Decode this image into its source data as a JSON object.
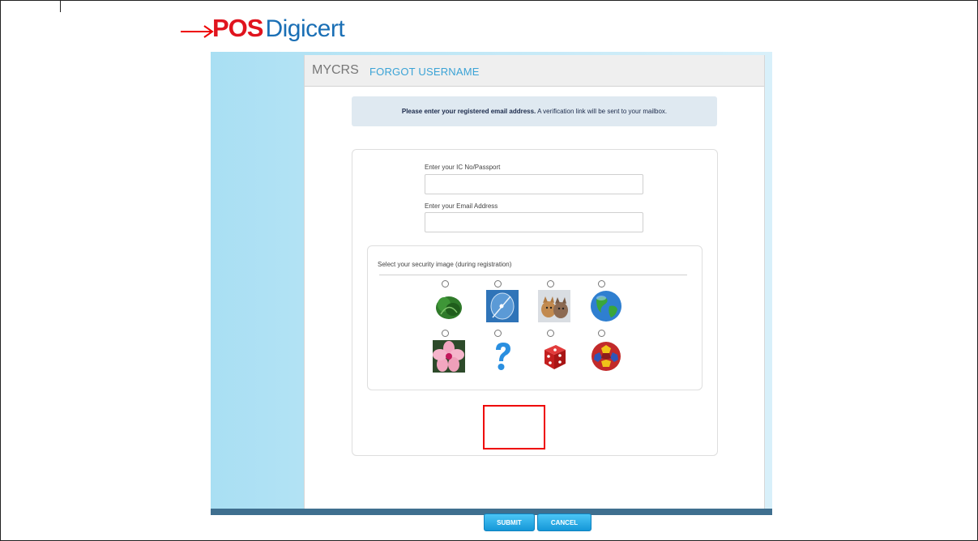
{
  "logo": {
    "brand_red": "POS",
    "brand_blue": "Digicert",
    "red_color": "#e0141e",
    "blue_color": "#1a6fb5"
  },
  "header": {
    "app_name": "MYCRS",
    "page_title": "FORGOT USERNAME"
  },
  "notice": {
    "bold_text": "Please enter your registered email address.",
    "text": " A verification link will be sent to your mailbox."
  },
  "form": {
    "ic_label": "Enter your IC No/Passport",
    "ic_value": "",
    "email_label": "Enter your Email Address",
    "email_value": ""
  },
  "security": {
    "label": "Select your security image (during registration)",
    "images": [
      {
        "icon": "lettuce-icon",
        "selected": false
      },
      {
        "icon": "satellite-dish-icon",
        "selected": false
      },
      {
        "icon": "kittens-icon",
        "selected": false
      },
      {
        "icon": "globe-icon",
        "selected": false
      },
      {
        "icon": "hibiscus-flower-icon",
        "selected": false
      },
      {
        "icon": "question-mark-icon",
        "selected": false
      },
      {
        "icon": "dice-icon",
        "selected": false
      },
      {
        "icon": "polyhedron-ball-icon",
        "selected": false
      }
    ]
  },
  "buttons": {
    "submit": "SUBMIT",
    "cancel": "CANCEL",
    "color": "#1597d8"
  },
  "annotations": {
    "highlight_color": "#ee0000"
  }
}
